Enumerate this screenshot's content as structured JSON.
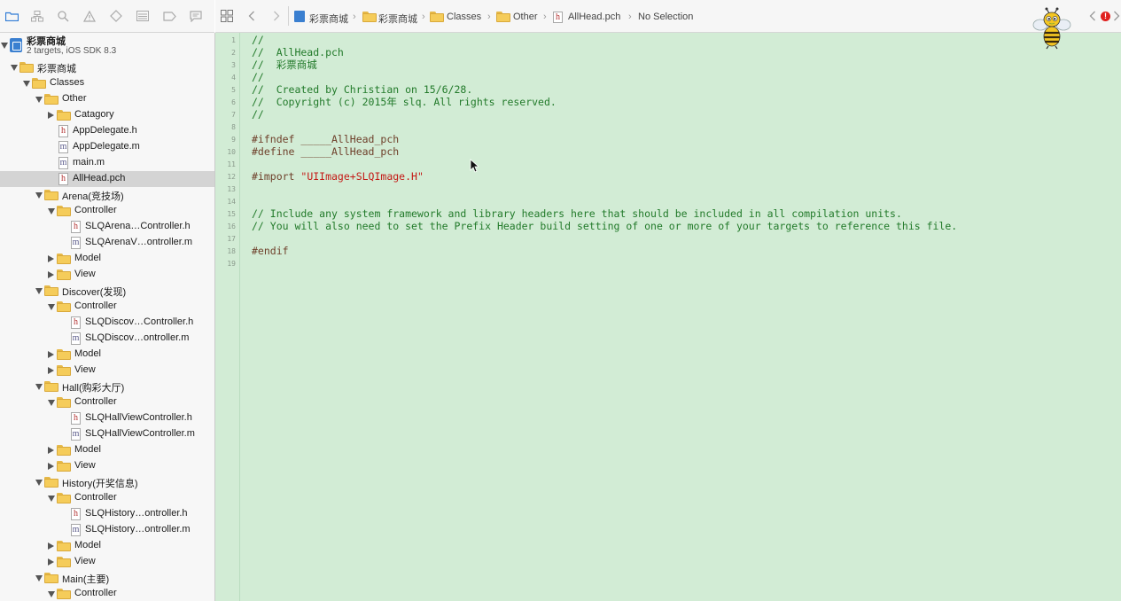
{
  "toolbar_icons": [
    "folder-icon",
    "hierarchy-icon",
    "search-icon",
    "warning-icon",
    "diamond-icon",
    "list-icon",
    "tag-icon",
    "comment-icon",
    "grid-icon",
    "back-arrow-icon",
    "forward-arrow-icon"
  ],
  "breadcrumbs": {
    "project": "彩票商城",
    "group": "彩票商城",
    "classes": "Classes",
    "other": "Other",
    "file": "AllHead.pch",
    "selection": "No Selection"
  },
  "project": {
    "name": "彩票商城",
    "subtitle": "2 targets, iOS SDK 8.3"
  },
  "tree": [
    {
      "label": "彩票商城",
      "depth": 1,
      "kind": "folder",
      "open": true
    },
    {
      "label": "Classes",
      "depth": 2,
      "kind": "folder",
      "open": true
    },
    {
      "label": "Other",
      "depth": 3,
      "kind": "folder",
      "open": true
    },
    {
      "label": "Catagory",
      "depth": 4,
      "kind": "folder",
      "open": false
    },
    {
      "label": "AppDelegate.h",
      "depth": 4,
      "kind": "h"
    },
    {
      "label": "AppDelegate.m",
      "depth": 4,
      "kind": "m"
    },
    {
      "label": "main.m",
      "depth": 4,
      "kind": "m"
    },
    {
      "label": "AllHead.pch",
      "depth": 4,
      "kind": "h",
      "selected": true
    },
    {
      "label": "Arena(竞技场)",
      "depth": 3,
      "kind": "folder",
      "open": true
    },
    {
      "label": "Controller",
      "depth": 4,
      "kind": "folder",
      "open": true
    },
    {
      "label": "SLQArena…Controller.h",
      "depth": 5,
      "kind": "h"
    },
    {
      "label": "SLQArenaV…ontroller.m",
      "depth": 5,
      "kind": "m"
    },
    {
      "label": "Model",
      "depth": 4,
      "kind": "folder",
      "open": false
    },
    {
      "label": "View",
      "depth": 4,
      "kind": "folder",
      "open": false
    },
    {
      "label": "Discover(发现)",
      "depth": 3,
      "kind": "folder",
      "open": true
    },
    {
      "label": "Controller",
      "depth": 4,
      "kind": "folder",
      "open": true
    },
    {
      "label": "SLQDiscov…Controller.h",
      "depth": 5,
      "kind": "h"
    },
    {
      "label": "SLQDiscov…ontroller.m",
      "depth": 5,
      "kind": "m"
    },
    {
      "label": "Model",
      "depth": 4,
      "kind": "folder",
      "open": false
    },
    {
      "label": "View",
      "depth": 4,
      "kind": "folder",
      "open": false
    },
    {
      "label": "Hall(购彩大厅)",
      "depth": 3,
      "kind": "folder",
      "open": true
    },
    {
      "label": "Controller",
      "depth": 4,
      "kind": "folder",
      "open": true
    },
    {
      "label": "SLQHallViewController.h",
      "depth": 5,
      "kind": "h"
    },
    {
      "label": "SLQHallViewController.m",
      "depth": 5,
      "kind": "m"
    },
    {
      "label": "Model",
      "depth": 4,
      "kind": "folder",
      "open": false
    },
    {
      "label": "View",
      "depth": 4,
      "kind": "folder",
      "open": false
    },
    {
      "label": "History(开奖信息)",
      "depth": 3,
      "kind": "folder",
      "open": true
    },
    {
      "label": "Controller",
      "depth": 4,
      "kind": "folder",
      "open": true
    },
    {
      "label": "SLQHistory…ontroller.h",
      "depth": 5,
      "kind": "h"
    },
    {
      "label": "SLQHistory…ontroller.m",
      "depth": 5,
      "kind": "m"
    },
    {
      "label": "Model",
      "depth": 4,
      "kind": "folder",
      "open": false
    },
    {
      "label": "View",
      "depth": 4,
      "kind": "folder",
      "open": false
    },
    {
      "label": "Main(主要)",
      "depth": 3,
      "kind": "folder",
      "open": true
    },
    {
      "label": "Controller",
      "depth": 4,
      "kind": "folder",
      "open": true
    }
  ],
  "code_lines": [
    {
      "n": "1",
      "text": "//",
      "style": "comment"
    },
    {
      "n": "2",
      "text": "//  AllHead.pch",
      "style": "comment"
    },
    {
      "n": "3",
      "text": "//  彩票商城",
      "style": "comment"
    },
    {
      "n": "4",
      "text": "//",
      "style": "comment"
    },
    {
      "n": "5",
      "text": "//  Created by Christian on 15/6/28.",
      "style": "comment"
    },
    {
      "n": "6",
      "text": "//  Copyright (c) 2015年 slq. All rights reserved.",
      "style": "comment"
    },
    {
      "n": "7",
      "text": "//",
      "style": "comment"
    },
    {
      "n": "8",
      "text": "",
      "style": "comment"
    },
    {
      "n": "9",
      "text": "#ifndef _____AllHead_pch",
      "style": "pre"
    },
    {
      "n": "10",
      "text": "#define _____AllHead_pch",
      "style": "pre"
    },
    {
      "n": "11",
      "text": "",
      "style": "pre"
    },
    {
      "n": "12",
      "pre": "#import ",
      "str": "\"UIImage+SLQImage.H\"",
      "style": "import"
    },
    {
      "n": "13",
      "text": "",
      "style": "pre"
    },
    {
      "n": "14",
      "text": "",
      "style": "pre"
    },
    {
      "n": "15",
      "text": "// Include any system framework and library headers here that should be included in all compilation units.",
      "style": "comment"
    },
    {
      "n": "16",
      "text": "// You will also need to set the Prefix Header build setting of one or more of your targets to reference this file.",
      "style": "comment"
    },
    {
      "n": "17",
      "text": "",
      "style": "comment"
    },
    {
      "n": "18",
      "text": "#endif",
      "style": "pre"
    },
    {
      "n": "19",
      "text": "",
      "style": "pre"
    }
  ],
  "status": {
    "error_badge": "!"
  },
  "colors": {
    "editor_bg": "#d2ecd5",
    "comment": "#227a2a",
    "preprocessor": "#6e3f2a",
    "string": "#c41a16",
    "error": "#e0201e"
  }
}
